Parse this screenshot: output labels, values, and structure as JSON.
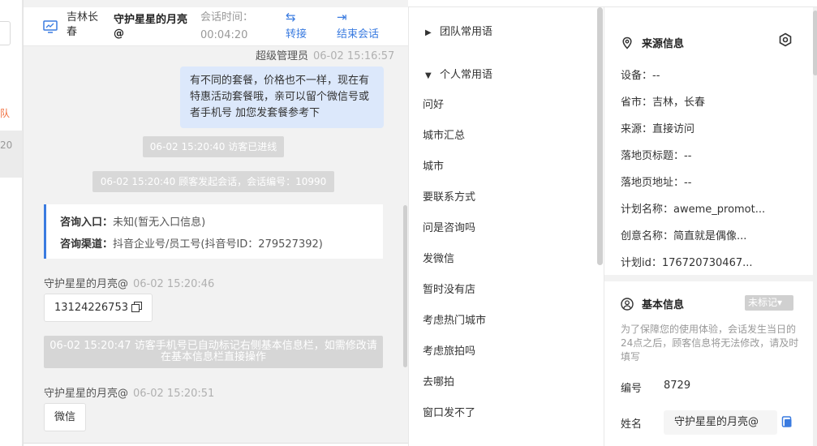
{
  "left": {
    "tab_text": "队",
    "time_text": "20"
  },
  "header": {
    "location": "吉林长春",
    "visitor_name": "守护星星的月亮@",
    "session_label": "会话时间：",
    "session_time": "00:04:20",
    "transfer_icon": "⇆",
    "transfer_label": "转接",
    "end_icon": "⇥",
    "end_label": "结束会话"
  },
  "messages": {
    "agent_sender": "超级管理员",
    "agent_time": "06-02 15:16:57",
    "agent_text": "有不同的套餐，价格也不一样，现在有特惠活动套餐哦，亲可以留个微信号或者手机号 加您发套餐参考下",
    "sys1": "06-02 15:20:40 访客已进线",
    "sys2": "06-02 15:20:40 顾客发起会话，会话编号：10990",
    "consult_entry_label": "咨询入口：",
    "consult_entry_value": "未知(暂无入口信息)",
    "consult_channel_label": "咨询渠道：",
    "consult_channel_value": "抖音企业号/员工号(抖音号ID：279527392)",
    "v1_sender": "守护星星的月亮@",
    "v1_time": "06-02 15:20:46",
    "v1_text": "13124226753",
    "sys3_line1": "06-02 15:20:47 访客手机号已自动标记右侧基本信息栏，如需修改请",
    "sys3_line2": "在基本信息栏直接操作",
    "v2_sender": "守护星星的月亮@",
    "v2_time": "06-02 15:20:51",
    "v2_text": "微信"
  },
  "phrases": {
    "team_group": "团队常用语",
    "personal_group": "个人常用语",
    "items": [
      "问好",
      "城市汇总",
      "城市",
      "要联系方式",
      "问是咨询吗",
      "发微信",
      "暂时没有店",
      "考虑热门城市",
      "考虑旅拍吗",
      "去哪拍",
      "窗口发不了"
    ]
  },
  "info": {
    "source_title": "来源信息",
    "device": "设备：--",
    "province": "省市：吉林，长春",
    "source": "来源：直接访问",
    "landing_title": "落地页标题：--",
    "landing_url": "落地页地址：--",
    "plan_name": "计划名称：aweme_promot...",
    "creative_name": "创意名称：简直就是偶像...",
    "plan_id": "计划id：176720730467...",
    "basic_title": "基本信息",
    "tag_label": "未标记▾",
    "note": "为了保障您的使用体验，会话发生当日的24点之后，顾客信息将无法修改，请及时填写",
    "id_label": "编号",
    "id_value": "8729",
    "name_label": "姓名",
    "name_value": "守护星星的月亮@"
  }
}
